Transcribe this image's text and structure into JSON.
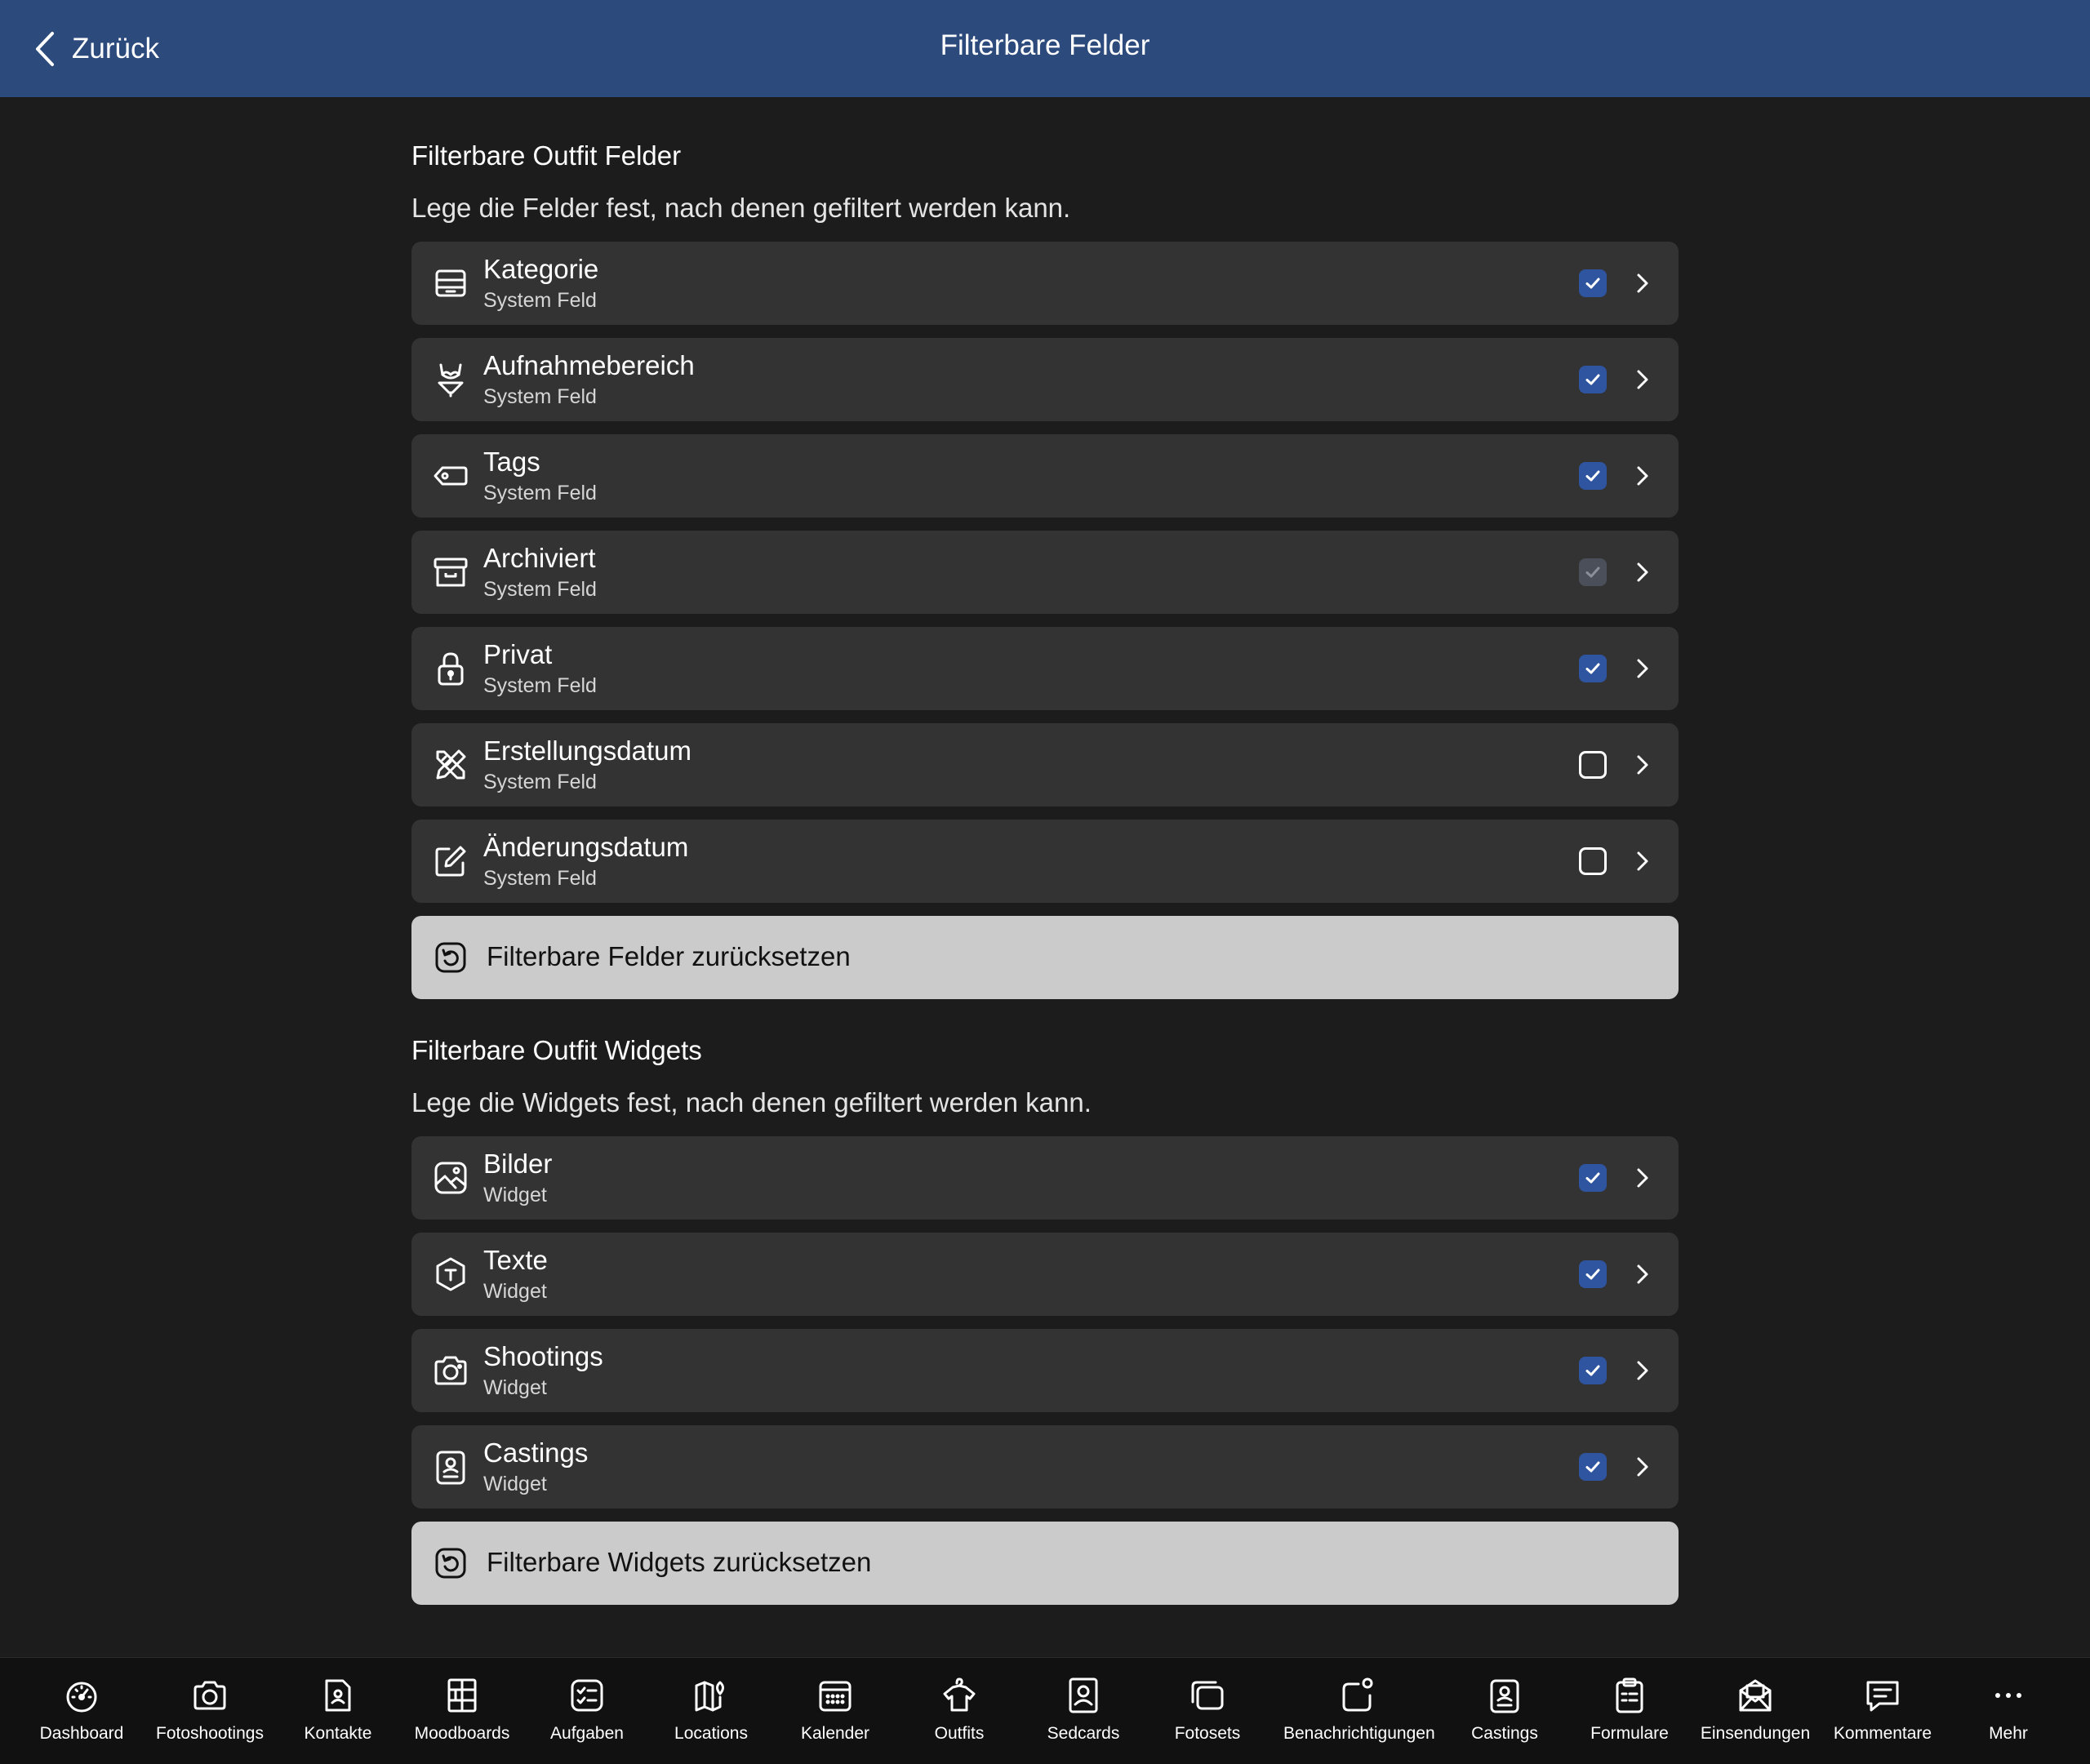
{
  "header": {
    "back_label": "Zurück",
    "title": "Filterbare Felder",
    "background": "#2c4a7c"
  },
  "fields_section": {
    "title": "Filterbare Outfit Felder",
    "description": "Lege die Felder fest, nach denen gefiltert werden kann.",
    "items": [
      {
        "title": "Kategorie",
        "subtitle": "System Feld",
        "icon": "category-drawer-icon",
        "checked": true
      },
      {
        "title": "Aufnahmebereich",
        "subtitle": "System Feld",
        "icon": "bikini-icon",
        "checked": true
      },
      {
        "title": "Tags",
        "subtitle": "System Feld",
        "icon": "tag-icon",
        "checked": true
      },
      {
        "title": "Archiviert",
        "subtitle": "System Feld",
        "icon": "archive-box-icon",
        "checked": true,
        "disabled": true
      },
      {
        "title": "Privat",
        "subtitle": "System Feld",
        "icon": "lock-icon",
        "checked": true
      },
      {
        "title": "Erstellungsdatum",
        "subtitle": "System Feld",
        "icon": "pencil-ruler-icon",
        "checked": false
      },
      {
        "title": "Änderungsdatum",
        "subtitle": "System Feld",
        "icon": "edit-square-icon",
        "checked": false
      }
    ],
    "reset_label": "Filterbare Felder zurücksetzen"
  },
  "widgets_section": {
    "title": "Filterbare Outfit Widgets",
    "description": "Lege die Widgets fest, nach denen gefiltert werden kann.",
    "items": [
      {
        "title": "Bilder",
        "subtitle": "Widget",
        "icon": "image-icon",
        "checked": true
      },
      {
        "title": "Texte",
        "subtitle": "Widget",
        "icon": "text-hexagon-icon",
        "checked": true
      },
      {
        "title": "Shootings",
        "subtitle": "Widget",
        "icon": "camera-icon",
        "checked": true
      },
      {
        "title": "Castings",
        "subtitle": "Widget",
        "icon": "casting-card-icon",
        "checked": true
      }
    ],
    "reset_label": "Filterbare Widgets zurücksetzen"
  },
  "tabbar": {
    "items": [
      {
        "label": "Dashboard",
        "icon": "dashboard-gauge-icon"
      },
      {
        "label": "Fotoshootings",
        "icon": "camera-icon"
      },
      {
        "label": "Kontakte",
        "icon": "contact-file-icon"
      },
      {
        "label": "Moodboards",
        "icon": "moodboard-grid-icon"
      },
      {
        "label": "Aufgaben",
        "icon": "task-list-icon"
      },
      {
        "label": "Locations",
        "icon": "map-pin-icon"
      },
      {
        "label": "Kalender",
        "icon": "calendar-icon"
      },
      {
        "label": "Outfits",
        "icon": "shirt-hanger-icon"
      },
      {
        "label": "Sedcards",
        "icon": "sedcard-icon"
      },
      {
        "label": "Fotosets",
        "icon": "photo-stack-icon"
      },
      {
        "label": "Benachrichtigungen",
        "icon": "notification-icon"
      },
      {
        "label": "Castings",
        "icon": "casting-card-icon"
      },
      {
        "label": "Formulare",
        "icon": "clipboard-form-icon"
      },
      {
        "label": "Einsendungen",
        "icon": "mail-open-icon"
      },
      {
        "label": "Kommentare",
        "icon": "comment-icon"
      },
      {
        "label": "Mehr",
        "icon": "more-dots-icon"
      }
    ]
  },
  "colors": {
    "background": "#1c1c1c",
    "row": "#333333",
    "checkbox_checked": "#2f55a0",
    "reset_button": "#cbcbcb",
    "tabbar": "#111111"
  }
}
